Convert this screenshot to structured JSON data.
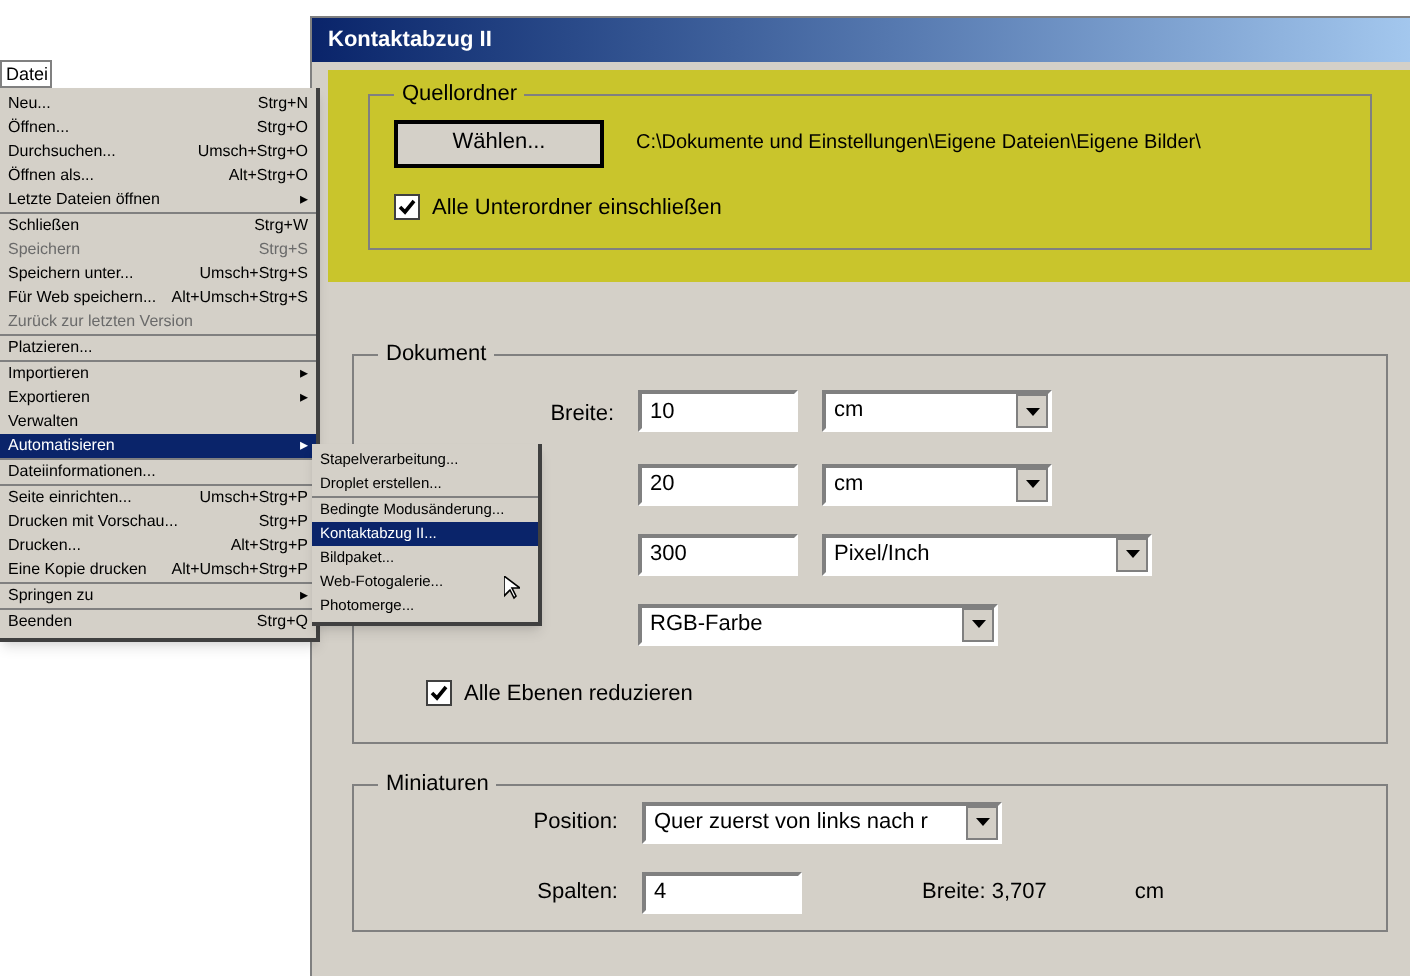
{
  "menu_bar": {
    "title": "Datei"
  },
  "file_menu": {
    "groups": [
      [
        {
          "label": "Neu...",
          "shortcut": "Strg+N",
          "disabled": false,
          "selected": false
        },
        {
          "label": "Öffnen...",
          "shortcut": "Strg+O",
          "disabled": false,
          "selected": false
        },
        {
          "label": "Durchsuchen...",
          "shortcut": "Umsch+Strg+O",
          "disabled": false,
          "selected": false
        },
        {
          "label": "Öffnen als...",
          "shortcut": "Alt+Strg+O",
          "disabled": false,
          "selected": false
        },
        {
          "label": "Letzte Dateien öffnen",
          "shortcut": "▸",
          "disabled": false,
          "selected": false
        }
      ],
      [
        {
          "label": "Schließen",
          "shortcut": "Strg+W",
          "disabled": false,
          "selected": false
        },
        {
          "label": "Speichern",
          "shortcut": "Strg+S",
          "disabled": true,
          "selected": false
        },
        {
          "label": "Speichern unter...",
          "shortcut": "Umsch+Strg+S",
          "disabled": false,
          "selected": false
        },
        {
          "label": "Für Web speichern...",
          "shortcut": "Alt+Umsch+Strg+S",
          "disabled": false,
          "selected": false
        },
        {
          "label": "Zurück zur letzten Version",
          "disabled": true,
          "selected": false
        }
      ],
      [
        {
          "label": "Platzieren...",
          "disabled": false,
          "selected": false
        }
      ],
      [
        {
          "label": "Importieren",
          "shortcut": "▸",
          "disabled": false,
          "selected": false
        },
        {
          "label": "Exportieren",
          "shortcut": "▸",
          "disabled": false,
          "selected": false
        },
        {
          "label": "Verwalten",
          "disabled": false,
          "selected": false
        },
        {
          "label": "Automatisieren",
          "shortcut": "▸",
          "disabled": false,
          "selected": true
        }
      ],
      [
        {
          "label": "Dateiinformationen...",
          "disabled": false,
          "selected": false
        }
      ],
      [
        {
          "label": "Seite einrichten...",
          "shortcut": "Umsch+Strg+P",
          "disabled": false,
          "selected": false
        },
        {
          "label": "Drucken mit Vorschau...",
          "shortcut": "Strg+P",
          "disabled": false,
          "selected": false
        },
        {
          "label": "Drucken...",
          "shortcut": "Alt+Strg+P",
          "disabled": false,
          "selected": false
        },
        {
          "label": "Eine Kopie drucken",
          "shortcut": "Alt+Umsch+Strg+P",
          "disabled": false,
          "selected": false
        }
      ],
      [
        {
          "label": "Springen zu",
          "shortcut": "▸",
          "disabled": false,
          "selected": false
        }
      ],
      [
        {
          "label": "Beenden",
          "shortcut": "Strg+Q",
          "disabled": false,
          "selected": false
        }
      ]
    ]
  },
  "submenu": {
    "groups": [
      [
        {
          "label": "Stapelverarbeitung...",
          "selected": false
        },
        {
          "label": "Droplet erstellen...",
          "selected": false
        }
      ],
      [
        {
          "label": "Bedingte Modusänderung...",
          "selected": false
        },
        {
          "label": "Kontaktabzug II...",
          "selected": true
        },
        {
          "label": "Bildpaket...",
          "selected": false
        },
        {
          "label": "Web-Fotogalerie...",
          "selected": false
        },
        {
          "label": "Photomerge...",
          "selected": false
        }
      ]
    ]
  },
  "dialog": {
    "title": "Kontaktabzug II",
    "source": {
      "legend": "Quellordner",
      "button": "Wählen...",
      "path": "C:\\Dokumente und Einstellungen\\Eigene Dateien\\Eigene Bilder\\",
      "include_subfolders": {
        "label": "Alle Unterordner einschließen",
        "checked": true
      }
    },
    "document": {
      "legend": "Dokument",
      "rows": [
        {
          "label": "Breite:",
          "value": "10",
          "unit": "cm"
        },
        {
          "value": "20",
          "unit": "cm"
        },
        {
          "value": "300",
          "unit": "Pixel/Inch"
        }
      ],
      "mode": "RGB-Farbe",
      "flatten": {
        "label": "Alle Ebenen reduzieren",
        "checked": true
      }
    },
    "thumbnails": {
      "legend": "Miniaturen",
      "position_label": "Position:",
      "position": "Quer zuerst von links nach r",
      "columns_label": "Spalten:",
      "columns": "4",
      "width_info": "Breite: 3,707",
      "width_unit": "cm"
    }
  }
}
